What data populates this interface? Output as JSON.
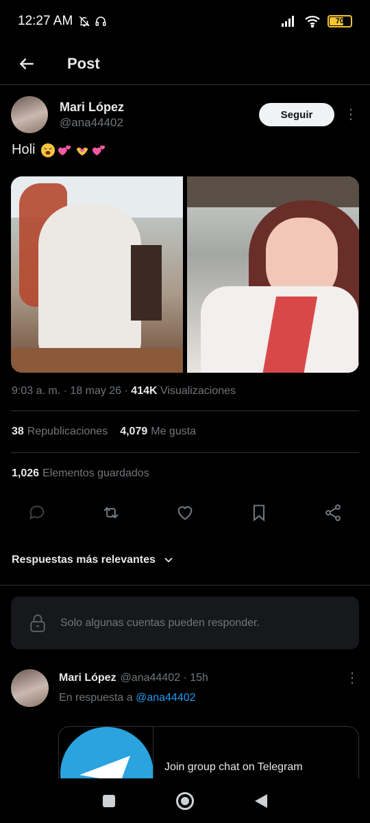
{
  "status_bar": {
    "time": "12:27 AM",
    "battery": "70",
    "battery_level_percent": 70
  },
  "header": {
    "title": "Post"
  },
  "post": {
    "display_name": "Mari López",
    "handle": "@ana44402",
    "follow_label": "Seguir",
    "text": "Holi",
    "emojis": [
      "weary-face",
      "two-hearts",
      "heart-hands",
      "two-hearts"
    ],
    "timestamp": "9:03 a. m. · 18 may 26 · ",
    "views_count": "414K",
    "views_label": " Visualizaciones",
    "reposts_count": "38",
    "reposts_label": "Republicaciones",
    "likes_count": "4,079",
    "likes_label": "Me gusta",
    "bookmarks_count": "1,026",
    "bookmarks_label": "Elementos guardados"
  },
  "replies_sort": {
    "label": "Respuestas más relevantes"
  },
  "restricted": {
    "label": "Solo algunas cuentas pueden responder."
  },
  "reply": {
    "display_name": "Mari López",
    "handle_time": "@ana44402 · 15h",
    "in_reply_prefix": "En respuesta a ",
    "in_reply_handle": "@ana44402",
    "card_title": "Join group chat on Telegram"
  },
  "colors": {
    "accent": "#1d9bf0",
    "background": "#000000",
    "muted": "#71767b",
    "telegram": "#2aa3df",
    "battery": "#f4c430"
  }
}
